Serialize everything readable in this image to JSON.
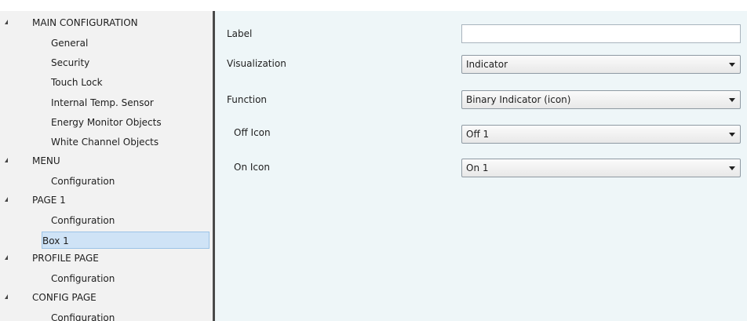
{
  "tree": {
    "items": [
      {
        "label": "MAIN CONFIGURATION",
        "level": 0,
        "expanded": true
      },
      {
        "label": "General",
        "level": 1
      },
      {
        "label": "Security",
        "level": 1
      },
      {
        "label": "Touch Lock",
        "level": 1
      },
      {
        "label": "Internal Temp. Sensor",
        "level": 1
      },
      {
        "label": "Energy Monitor Objects",
        "level": 1
      },
      {
        "label": "White Channel Objects",
        "level": 1
      },
      {
        "label": "MENU",
        "level": 0,
        "expanded": true
      },
      {
        "label": "Configuration",
        "level": 1
      },
      {
        "label": "PAGE 1",
        "level": 0,
        "expanded": true
      },
      {
        "label": "Configuration",
        "level": 1
      },
      {
        "label": "Box 1",
        "level": 1,
        "selected": true
      },
      {
        "label": "PROFILE PAGE",
        "level": 0,
        "expanded": true
      },
      {
        "label": "Configuration",
        "level": 1
      },
      {
        "label": "CONFIG PAGE",
        "level": 0,
        "expanded": true
      },
      {
        "label": "Configuration",
        "level": 1
      }
    ]
  },
  "form": {
    "label": {
      "caption": "Label",
      "value": ""
    },
    "visualization": {
      "caption": "Visualization",
      "value": "Indicator"
    },
    "function": {
      "caption": "Function",
      "value": "Binary Indicator (icon)"
    },
    "off_icon": {
      "caption": "Off Icon",
      "value": "Off 1"
    },
    "on_icon": {
      "caption": "On Icon",
      "value": "On 1"
    }
  },
  "icons": {
    "expand": "expanded-triangle-icon",
    "dropdown": "chevron-down-icon"
  },
  "colors": {
    "tree_bg": "#f2f2f2",
    "pane_bg": "#eef6f8",
    "selected_bg": "#cfe3f6",
    "splitter": "#4a4a4a"
  }
}
